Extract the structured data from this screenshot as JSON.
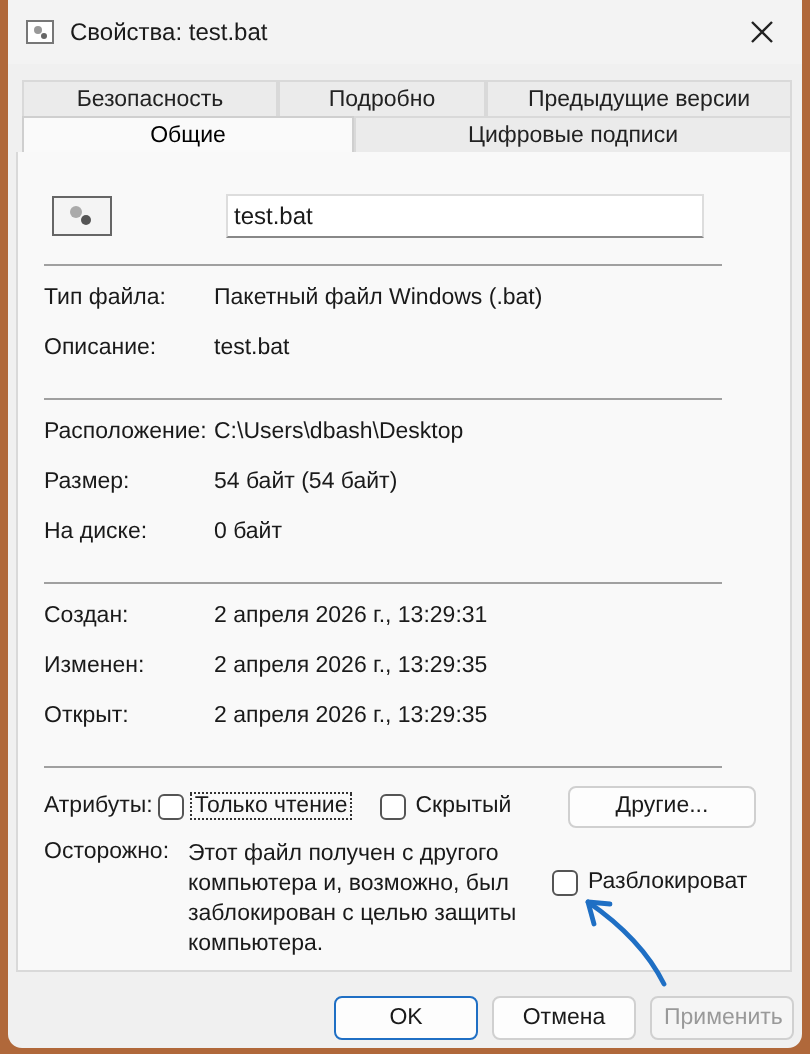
{
  "window": {
    "title": "Свойства: test.bat"
  },
  "tabs": [
    [
      {
        "label": "Безопасность",
        "selected": false
      },
      {
        "label": "Подробно",
        "selected": false
      },
      {
        "label": "Предыдущие версии",
        "selected": false
      }
    ],
    [
      {
        "label": "Общие",
        "selected": true
      },
      {
        "label": "Цифровые подписи",
        "selected": false
      }
    ]
  ],
  "file_name": "test.bat",
  "sections": [
    [
      {
        "label": "Тип файла:",
        "value": "Пакетный файл Windows (.bat)"
      },
      {
        "label": "Описание:",
        "value": "test.bat"
      }
    ],
    [
      {
        "label": "Расположение:",
        "value": "C:\\Users\\dbash\\Desktop"
      },
      {
        "label": "Размер:",
        "value": "54 байт (54 байт)"
      },
      {
        "label": "На диске:",
        "value": "0 байт"
      }
    ],
    [
      {
        "label": "Создан:",
        "value": "2 апреля 2026 г., 13:29:31"
      },
      {
        "label": "Изменен:",
        "value": "2 апреля 2026 г., 13:29:35"
      },
      {
        "label": "Открыт:",
        "value": "2 апреля 2026 г., 13:29:35"
      }
    ]
  ],
  "attributes": {
    "label": "Атрибуты:",
    "checkboxes": [
      {
        "label": "Только чтение",
        "checked": false,
        "focused": true
      },
      {
        "label": "Скрытый",
        "checked": false,
        "focused": false
      }
    ],
    "other_button": "Другие..."
  },
  "security": {
    "label": "Осторожно:",
    "text": "Этот файл получен с другого компьютера и, возможно, был заблокирован с целью защиты компьютера.",
    "unblock": {
      "label": "Разблокироват",
      "checked": false
    }
  },
  "buttons": [
    {
      "label": "OK",
      "kind": "default",
      "disabled": false
    },
    {
      "label": "Отмена",
      "kind": "normal",
      "disabled": false
    },
    {
      "label": "Применить",
      "kind": "normal",
      "disabled": true
    }
  ]
}
